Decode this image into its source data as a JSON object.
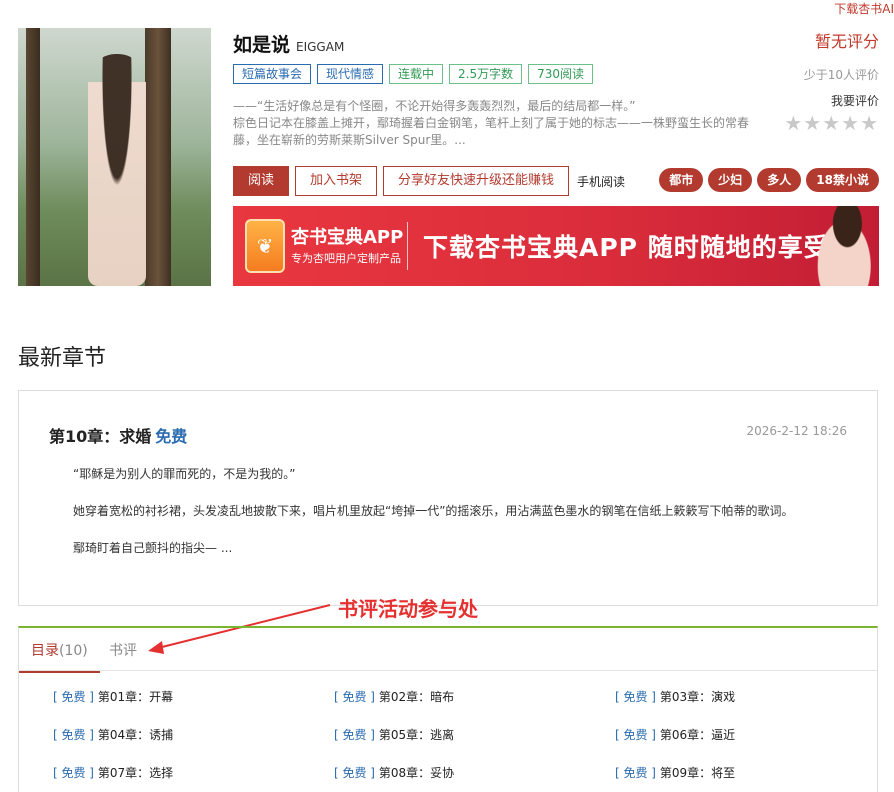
{
  "top_link": "下载杏书AI",
  "book": {
    "title": "如是说",
    "author": "EIGGAM",
    "tags": [
      "短篇故事会",
      "现代情感",
      "连载中",
      "2.5万字数",
      "730阅读"
    ],
    "intro_line1": "——“生活好像总是有个怪圈，不论开始得多轰轰烈烈，最后的结局都一样。”",
    "intro_line2": "棕色日记本在膝盖上摊开，鄢琦握着白金钢笔，笔杆上刻了属于她的标志——一株野蛮生长的常春",
    "intro_line3": "藤，坐在崭新的劳斯莱斯Silver Spur里。..."
  },
  "score": {
    "main": "暂无评分",
    "sub": "少于10人评价",
    "rate_label": "我要评价",
    "stars": "★★★★★"
  },
  "actions": {
    "read": "阅读",
    "add_shelf": "加入书架",
    "share": "分享好友快速升级还能赚钱",
    "mobile_read": "手机阅读"
  },
  "genres": [
    "都市",
    "少妇",
    "多人",
    "18禁小说"
  ],
  "banner": {
    "app_name": "杏书宝典APP",
    "app_sub": "专为杏吧用户定制产品",
    "slogan": "下载杏书宝典APP 随时随地的享受"
  },
  "latest": {
    "section_title": "最新章节",
    "chapter_title": "第10章：求婚",
    "free_label": "免费",
    "time": "2026-2-12 18:26",
    "p1": "“耶稣是为别人的罪而死的，不是为我的。”",
    "p2": "她穿着宽松的衬衫裙，头发凌乱地披散下来，唱片机里放起“垮掉一代”的摇滚乐，用沾满蓝色墨水的钢笔在信纸上簌簌写下帕蒂的歌词。",
    "p3": "鄢琦盯着自己颤抖的指尖— ..."
  },
  "annotation": "书评活动参与处",
  "toc": {
    "tab_catalog": "目录",
    "tab_catalog_count": "(10)",
    "tab_review": "书评",
    "chapters": [
      {
        "free": "[ 免费 ]",
        "name": "第01章：开幕"
      },
      {
        "free": "[ 免费 ]",
        "name": "第02章：暗布"
      },
      {
        "free": "[ 免费 ]",
        "name": "第03章：演戏"
      },
      {
        "free": "[ 免费 ]",
        "name": "第04章：诱捕"
      },
      {
        "free": "[ 免费 ]",
        "name": "第05章：逃离"
      },
      {
        "free": "[ 免费 ]",
        "name": "第06章：逼近"
      },
      {
        "free": "[ 免费 ]",
        "name": "第07章：选择"
      },
      {
        "free": "[ 免费 ]",
        "name": "第08章：妥协"
      },
      {
        "free": "[ 免费 ]",
        "name": "第09章：将至"
      }
    ]
  }
}
